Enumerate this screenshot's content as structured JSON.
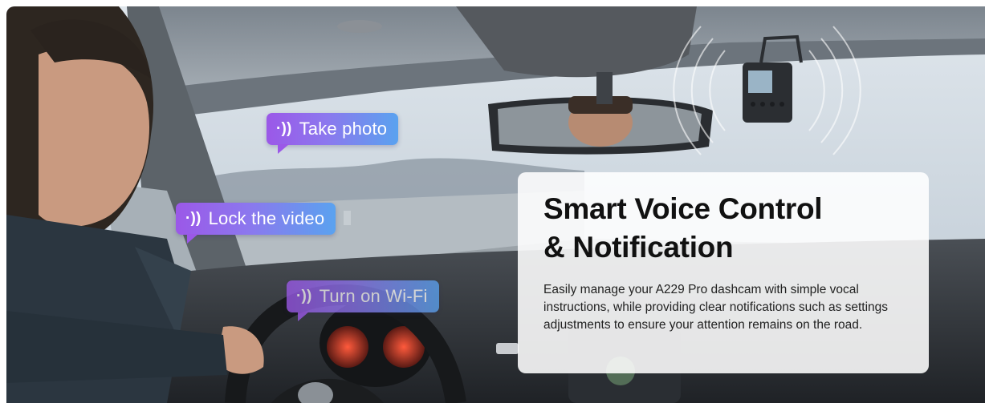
{
  "bubbles": [
    {
      "icon": "voice-wave-icon",
      "glyph": "·))",
      "label": "Take photo"
    },
    {
      "icon": "voice-wave-icon",
      "glyph": "·))",
      "label": "Lock the video"
    },
    {
      "icon": "voice-wave-icon",
      "glyph": "·))",
      "label": "Turn on Wi-Fi"
    }
  ],
  "panel": {
    "title_line1": "Smart Voice Control",
    "title_line2": "& Notification",
    "description": "Easily manage your A229 Pro dashcam with simple vocal instructions, while providing clear notifications such as settings adjustments to ensure your attention remains on the road."
  },
  "colors": {
    "bubble_start": "#9b58e8",
    "bubble_end": "#5aa2ef",
    "panel_bg": "#ffffff",
    "title_text": "#111111"
  }
}
